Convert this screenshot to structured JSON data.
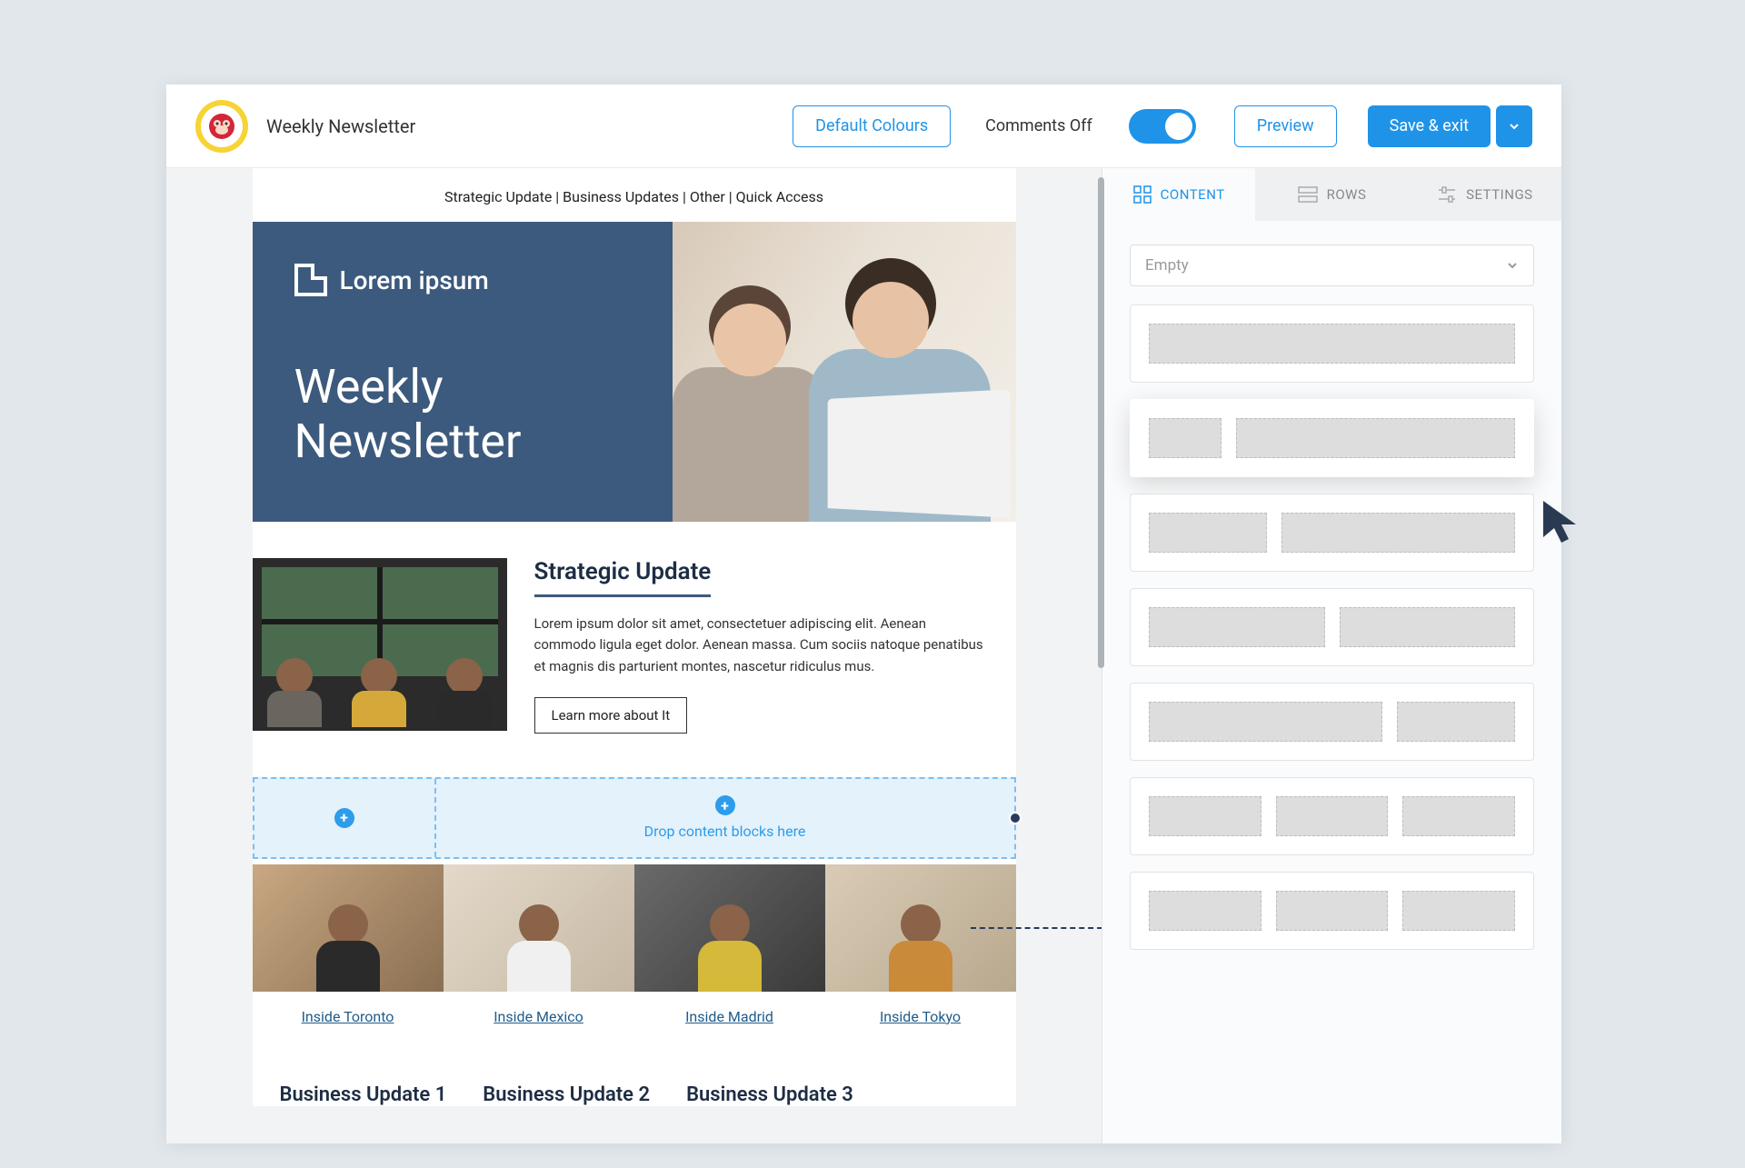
{
  "toolbar": {
    "doc_title": "Weekly Newsletter",
    "default_colours": "Default Colours",
    "comments_off": "Comments Off",
    "preview": "Preview",
    "save_exit": "Save & exit"
  },
  "anchors": {
    "a1": "Strategic Update",
    "a2": "Business Updates",
    "a3": "Other",
    "a4": "Quick Access",
    "sep": " | "
  },
  "hero": {
    "brand": "Lorem ipsum",
    "title_line1": "Weekly",
    "title_line2": "Newsletter"
  },
  "strategic": {
    "heading": "Strategic Update",
    "body": "Lorem ipsum dolor sit amet, consectetuer adipiscing elit. Aenean commodo ligula eget dolor. Aenean massa. Cum sociis natoque penatibus et magnis dis parturient montes, nascetur ridiculus mus.",
    "cta": "Learn more about It"
  },
  "dropzone": {
    "text": "Drop content blocks here"
  },
  "inside": {
    "items": [
      {
        "label": "Inside Toronto"
      },
      {
        "label": "Inside Mexico"
      },
      {
        "label": "Inside Madrid"
      },
      {
        "label": "Inside Tokyo"
      }
    ]
  },
  "business": {
    "items": [
      {
        "title": "Business Update 1"
      },
      {
        "title": "Business Update 2"
      },
      {
        "title": "Business Update 3"
      }
    ]
  },
  "side": {
    "tabs": {
      "content": "CONTENT",
      "rows": "ROWS",
      "settings": "SETTINGS"
    },
    "dropdown": "Empty"
  }
}
